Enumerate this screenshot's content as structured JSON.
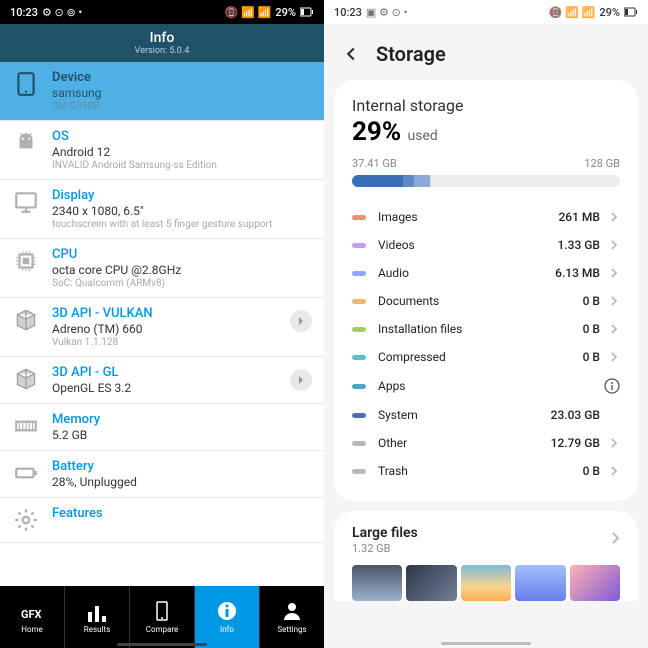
{
  "status": {
    "time": "10:23",
    "left_icons": "⚙ ⊙ ⊚ •",
    "right_icons": "📵 📶 📶",
    "battery": "29%"
  },
  "gfx": {
    "header_title": "Info",
    "header_version": "Version: 5.0.4",
    "rows": [
      {
        "title": "Device",
        "value": "samsung",
        "detail": "SM-G990B",
        "selected": true,
        "icon": "tablet"
      },
      {
        "title": "OS",
        "value": "Android 12",
        "detail": "INVALID Android Samsung-ss Edition",
        "icon": "android"
      },
      {
        "title": "Display",
        "value": "2340 x 1080, 6.5\"",
        "detail": "touchscreen with at least 5 finger gesture support",
        "icon": "monitor"
      },
      {
        "title": "CPU",
        "value": "octa core CPU @2.8GHz",
        "detail": "SoC: Qualcomm (ARMv8)",
        "icon": "chip"
      },
      {
        "title": "3D API - VULKAN",
        "value": "Adreno (TM) 660",
        "detail": "Vulkan 1.1.128",
        "icon": "cube",
        "chevron": true
      },
      {
        "title": "3D API - GL",
        "value": "OpenGL ES 3.2",
        "detail": "",
        "icon": "cube",
        "chevron": true
      },
      {
        "title": "Memory",
        "value": "5.2 GB",
        "detail": "",
        "icon": "ram"
      },
      {
        "title": "Battery",
        "value": "28%, Unplugged",
        "detail": "",
        "icon": "battery"
      },
      {
        "title": "Features",
        "value": "",
        "detail": "",
        "icon": "gear"
      }
    ],
    "nav": [
      "Home",
      "Results",
      "Compare",
      "Info",
      "Settings"
    ],
    "nav_active": 3
  },
  "storage": {
    "title": "Storage",
    "internal_title": "Internal storage",
    "percent": "29%",
    "used_label": "used",
    "used_size": "37.41 GB",
    "total_size": "128 GB",
    "bar": [
      {
        "color": "#3A6FB5",
        "w": 19
      },
      {
        "color": "#5C8BC7",
        "w": 4
      },
      {
        "color": "#8EA9D5",
        "w": 6
      },
      {
        "color": "#D6DCE8",
        "w": 0.5
      }
    ],
    "categories": [
      {
        "label": "Images",
        "size": "261 MB",
        "color": "#F08E6F",
        "chev": true
      },
      {
        "label": "Videos",
        "size": "1.33 GB",
        "color": "#C69BFF",
        "chev": true
      },
      {
        "label": "Audio",
        "size": "6.13 MB",
        "color": "#8FA5FF",
        "chev": true
      },
      {
        "label": "Documents",
        "size": "0 B",
        "color": "#E8B96E",
        "chev": true
      },
      {
        "label": "Installation files",
        "size": "0 B",
        "color": "#9ED257",
        "chev": true
      },
      {
        "label": "Compressed",
        "size": "0 B",
        "color": "#57C3C5",
        "chev": true
      },
      {
        "label": "Apps",
        "size": "",
        "color": "#4AA7C5",
        "info": true
      },
      {
        "label": "System",
        "size": "23.03 GB",
        "color": "#4B6FAF",
        "chev": false
      },
      {
        "label": "Other",
        "size": "12.79 GB",
        "color": "#B8B8B8",
        "chev": true
      },
      {
        "label": "Trash",
        "size": "0 B",
        "color": "#B8B8B8",
        "chev": true
      }
    ],
    "large_files_title": "Large files",
    "large_files_size": "1.32 GB"
  }
}
